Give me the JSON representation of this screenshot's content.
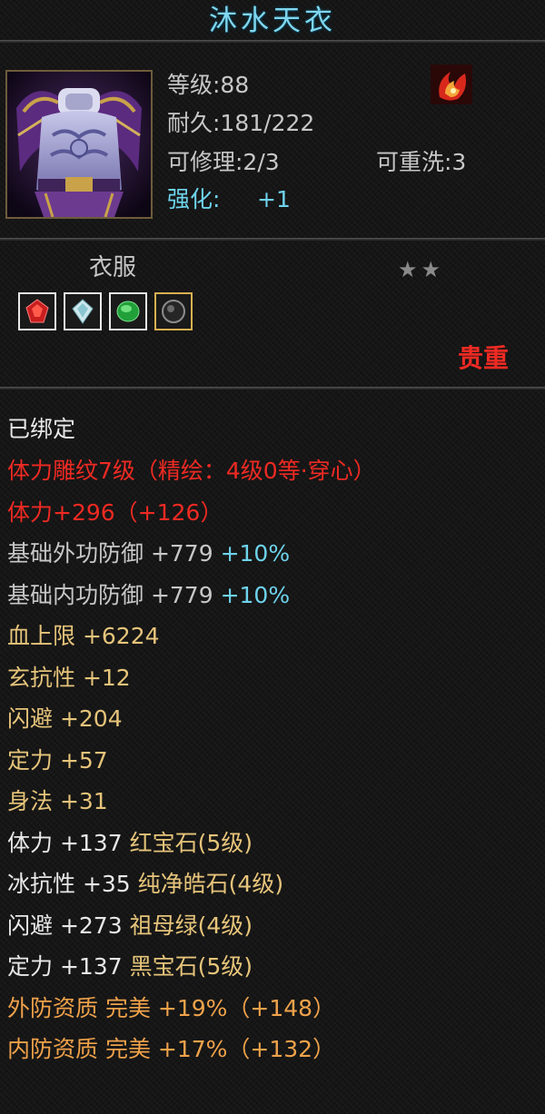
{
  "item": {
    "name": "沐水天衣",
    "level": "等级:88",
    "durability": "耐久:181/222",
    "repairable": "可修理:2/3",
    "rewash": "可重洗:3",
    "enhance_label": "强化:",
    "enhance_value": "+1",
    "type": "衣服",
    "stars": "★★",
    "rarity": "贵重",
    "bound": "已绑定",
    "icon": "purple-robe-armor",
    "skill_icon": "flame-swirl-icon",
    "gems": [
      "ruby-gem-icon",
      "diamond-gem-icon",
      "emerald-gem-icon",
      "black-gem-icon"
    ]
  },
  "attributes": [
    {
      "parts": [
        {
          "text": "体力雕纹7级（精绘：4级0等·穿心）",
          "color": "red"
        }
      ]
    },
    {
      "parts": [
        {
          "text": "体力+296（+126）",
          "color": "red"
        }
      ]
    },
    {
      "parts": [
        {
          "text": "基础外功防御 +779 ",
          "color": "grey"
        },
        {
          "text": "+10%",
          "color": "cyan"
        }
      ]
    },
    {
      "parts": [
        {
          "text": "基础内功防御 +779 ",
          "color": "grey"
        },
        {
          "text": "+10%",
          "color": "cyan"
        }
      ]
    },
    {
      "parts": [
        {
          "text": "血上限 ",
          "color": "gold"
        },
        {
          "text": "+6224",
          "color": "gold"
        }
      ]
    },
    {
      "parts": [
        {
          "text": "玄抗性 ",
          "color": "gold"
        },
        {
          "text": "+12",
          "color": "gold"
        }
      ]
    },
    {
      "parts": [
        {
          "text": "闪避 ",
          "color": "gold"
        },
        {
          "text": "+204",
          "color": "gold"
        }
      ]
    },
    {
      "parts": [
        {
          "text": "定力 ",
          "color": "gold"
        },
        {
          "text": "+57",
          "color": "gold"
        }
      ]
    },
    {
      "parts": [
        {
          "text": "身法 ",
          "color": "gold"
        },
        {
          "text": "+31",
          "color": "gold"
        }
      ]
    },
    {
      "parts": [
        {
          "text": "体力 +137 ",
          "color": "white"
        },
        {
          "text": "红宝石(5级)",
          "color": "gold"
        }
      ]
    },
    {
      "parts": [
        {
          "text": "冰抗性 +35 ",
          "color": "white"
        },
        {
          "text": "纯净皓石(4级)",
          "color": "gold"
        }
      ]
    },
    {
      "parts": [
        {
          "text": "闪避 +273 ",
          "color": "white"
        },
        {
          "text": "祖母绿(4级)",
          "color": "gold"
        }
      ]
    },
    {
      "parts": [
        {
          "text": "定力 +137 ",
          "color": "white"
        },
        {
          "text": "黑宝石(5级)",
          "color": "gold"
        }
      ]
    },
    {
      "parts": [
        {
          "text": "外防资质 完美 +19%（+148）",
          "color": "orange"
        }
      ]
    },
    {
      "parts": [
        {
          "text": "内防资质 完美 +17%（+132）",
          "color": "orange"
        }
      ]
    }
  ],
  "colors": {
    "red": "#ee2a23",
    "grey": "#c7c7c7",
    "cyan": "#6ed3ec",
    "gold": "#e6c47a",
    "white": "#e8e8e8",
    "orange": "#f0a24a"
  }
}
